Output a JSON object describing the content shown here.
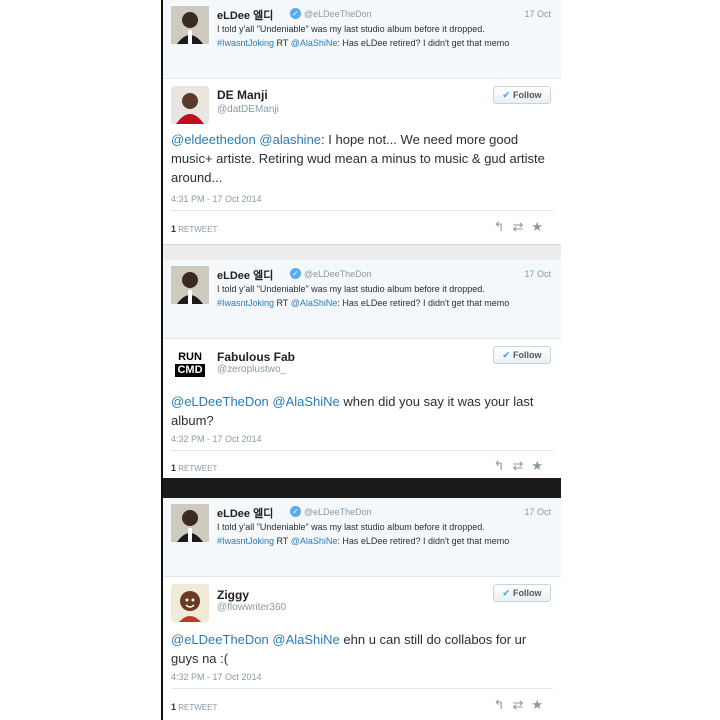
{
  "quoted": {
    "name": "eLDee 엘디",
    "handle": "@eLDeeTheDon",
    "date": "17 Oct",
    "text_line1": "I told y'all \"Undeniable\" was my last studio album before it dropped.",
    "hashtag": "#IwasntJoking",
    "rt": " RT ",
    "mention": "@AlaShiNe",
    "text_line2_rest": ": Has eLDee retired? I didn't get that memo"
  },
  "replies": [
    {
      "name": "DE Manji",
      "handle": "@datDEManji",
      "follow_label": "Follow",
      "mention1": "@eldeethedon",
      "mention2": "@alashine",
      "body": ": I hope not... We need more good music+ artiste. Retiring wud mean a minus to music & gud artiste around...",
      "time": "4:31 PM - 17 Oct 2014",
      "retweet_count": "1",
      "retweet_label": "RETWEET"
    },
    {
      "name": "Fabulous Fab",
      "handle": "@zeroplustwo_",
      "avatar_line1": "RUN",
      "avatar_line2": "CMD",
      "follow_label": "Follow",
      "mention1": "@eLDeeTheDon",
      "mention2": "@AlaShiNe",
      "body": " when did you say it was your last album?",
      "time": "4:32 PM - 17 Oct 2014",
      "retweet_count": "1",
      "retweet_label": "RETWEET"
    },
    {
      "name": "Ziggy",
      "handle": "@flowwriter360",
      "follow_label": "Follow",
      "mention1": "@eLDeeTheDon",
      "mention2": "@AlaShiNe",
      "body": " ehn u can still do collabos for ur guys na :(",
      "time": "4:32 PM - 17 Oct 2014",
      "retweet_count": "1",
      "retweet_label": "RETWEET"
    }
  ],
  "icons": {
    "reply": "↰",
    "retweet": "⇄",
    "favorite": "★",
    "verified": "✓",
    "follow_bird": "🐦"
  },
  "colors": {
    "link": "#2b7bb9",
    "verified": "#55acee",
    "muted": "#8899a6"
  }
}
